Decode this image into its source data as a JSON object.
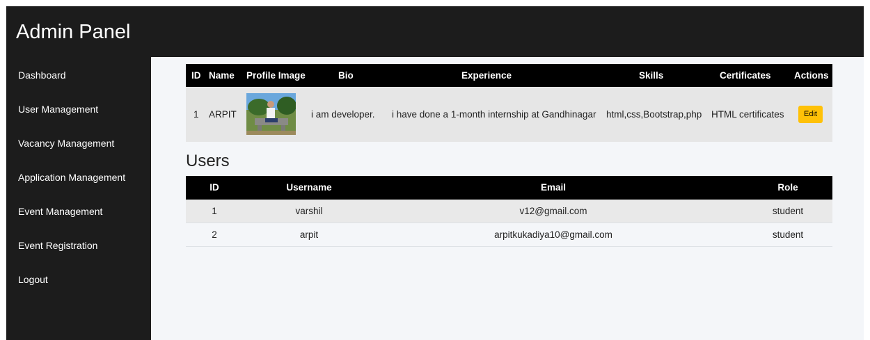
{
  "header": {
    "title": "Admin Panel"
  },
  "sidebar": {
    "items": [
      {
        "label": "Dashboard"
      },
      {
        "label": "User Management"
      },
      {
        "label": "Vacancy Management"
      },
      {
        "label": "Application Management"
      },
      {
        "label": "Event Management"
      },
      {
        "label": "Event Registration"
      },
      {
        "label": "Logout"
      }
    ]
  },
  "profile_table": {
    "headers": [
      "ID",
      "Name",
      "Profile Image",
      "Bio",
      "Experience",
      "Skills",
      "Certificates",
      "Actions"
    ],
    "rows": [
      {
        "id": "1",
        "name": "ARPIT",
        "bio": "i am developer.",
        "experience": "i have done a 1-month internship at Gandhinagar",
        "skills": "html,css,Bootstrap,php",
        "certificates": "HTML certificates",
        "action": "Edit"
      }
    ]
  },
  "users_section": {
    "title": "Users",
    "headers": [
      "ID",
      "Username",
      "Email",
      "Role"
    ],
    "rows": [
      {
        "id": "1",
        "username": "varshil",
        "email": "v12@gmail.com",
        "role": "student"
      },
      {
        "id": "2",
        "username": "arpit",
        "email": "arpitkukadiya10@gmail.com",
        "role": "student"
      }
    ]
  },
  "colors": {
    "sidebar_bg": "#1c1c1c",
    "content_bg": "#f4f6f9",
    "table_header_bg": "#000000",
    "edit_button": "#ffc107"
  }
}
